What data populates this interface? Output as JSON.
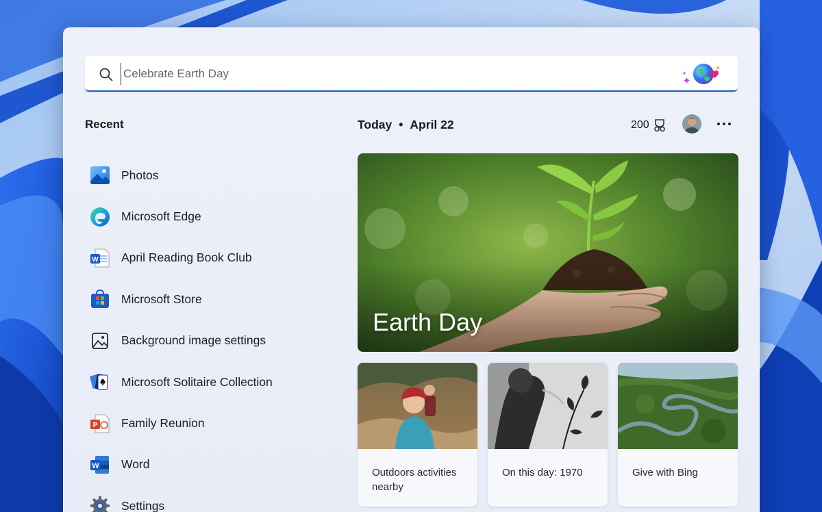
{
  "search": {
    "placeholder": "Celebrate Earth Day"
  },
  "recent": {
    "title": "Recent",
    "items": [
      {
        "label": "Photos",
        "icon": "photos-icon"
      },
      {
        "label": "Microsoft Edge",
        "icon": "edge-icon"
      },
      {
        "label": "April Reading Book Club",
        "icon": "word-doc-icon"
      },
      {
        "label": "Microsoft Store",
        "icon": "store-icon"
      },
      {
        "label": "Background image settings",
        "icon": "image-settings-icon"
      },
      {
        "label": "Microsoft Solitaire Collection",
        "icon": "solitaire-icon"
      },
      {
        "label": "Family Reunion",
        "icon": "powerpoint-icon"
      },
      {
        "label": "Word",
        "icon": "word-icon"
      },
      {
        "label": "Settings",
        "icon": "settings-icon"
      }
    ]
  },
  "today": {
    "label": "Today",
    "separator": "•",
    "date": "April 22",
    "points": "200"
  },
  "hero": {
    "title": "Earth Day"
  },
  "cards": [
    {
      "text": "Outdoors activities nearby"
    },
    {
      "text": "On this day: 1970"
    },
    {
      "text": "Give with Bing"
    }
  ],
  "colors": {
    "accent": "#1f5fbf",
    "panel": "#eef1f9",
    "wallpaper": "#3f7fe6"
  }
}
